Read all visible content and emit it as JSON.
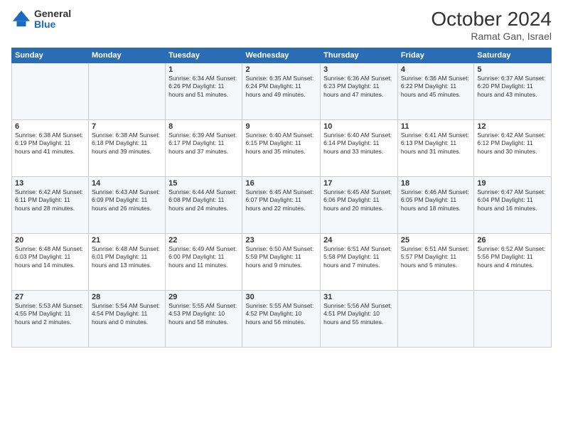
{
  "header": {
    "logo_general": "General",
    "logo_blue": "Blue",
    "month_title": "October 2024",
    "subtitle": "Ramat Gan, Israel"
  },
  "days_of_week": [
    "Sunday",
    "Monday",
    "Tuesday",
    "Wednesday",
    "Thursday",
    "Friday",
    "Saturday"
  ],
  "weeks": [
    [
      {
        "day": "",
        "info": ""
      },
      {
        "day": "",
        "info": ""
      },
      {
        "day": "1",
        "info": "Sunrise: 6:34 AM\nSunset: 6:26 PM\nDaylight: 11 hours and 51 minutes."
      },
      {
        "day": "2",
        "info": "Sunrise: 6:35 AM\nSunset: 6:24 PM\nDaylight: 11 hours and 49 minutes."
      },
      {
        "day": "3",
        "info": "Sunrise: 6:36 AM\nSunset: 6:23 PM\nDaylight: 11 hours and 47 minutes."
      },
      {
        "day": "4",
        "info": "Sunrise: 6:36 AM\nSunset: 6:22 PM\nDaylight: 11 hours and 45 minutes."
      },
      {
        "day": "5",
        "info": "Sunrise: 6:37 AM\nSunset: 6:20 PM\nDaylight: 11 hours and 43 minutes."
      }
    ],
    [
      {
        "day": "6",
        "info": "Sunrise: 6:38 AM\nSunset: 6:19 PM\nDaylight: 11 hours and 41 minutes."
      },
      {
        "day": "7",
        "info": "Sunrise: 6:38 AM\nSunset: 6:18 PM\nDaylight: 11 hours and 39 minutes."
      },
      {
        "day": "8",
        "info": "Sunrise: 6:39 AM\nSunset: 6:17 PM\nDaylight: 11 hours and 37 minutes."
      },
      {
        "day": "9",
        "info": "Sunrise: 6:40 AM\nSunset: 6:15 PM\nDaylight: 11 hours and 35 minutes."
      },
      {
        "day": "10",
        "info": "Sunrise: 6:40 AM\nSunset: 6:14 PM\nDaylight: 11 hours and 33 minutes."
      },
      {
        "day": "11",
        "info": "Sunrise: 6:41 AM\nSunset: 6:13 PM\nDaylight: 11 hours and 31 minutes."
      },
      {
        "day": "12",
        "info": "Sunrise: 6:42 AM\nSunset: 6:12 PM\nDaylight: 11 hours and 30 minutes."
      }
    ],
    [
      {
        "day": "13",
        "info": "Sunrise: 6:42 AM\nSunset: 6:11 PM\nDaylight: 11 hours and 28 minutes."
      },
      {
        "day": "14",
        "info": "Sunrise: 6:43 AM\nSunset: 6:09 PM\nDaylight: 11 hours and 26 minutes."
      },
      {
        "day": "15",
        "info": "Sunrise: 6:44 AM\nSunset: 6:08 PM\nDaylight: 11 hours and 24 minutes."
      },
      {
        "day": "16",
        "info": "Sunrise: 6:45 AM\nSunset: 6:07 PM\nDaylight: 11 hours and 22 minutes."
      },
      {
        "day": "17",
        "info": "Sunrise: 6:45 AM\nSunset: 6:06 PM\nDaylight: 11 hours and 20 minutes."
      },
      {
        "day": "18",
        "info": "Sunrise: 6:46 AM\nSunset: 6:05 PM\nDaylight: 11 hours and 18 minutes."
      },
      {
        "day": "19",
        "info": "Sunrise: 6:47 AM\nSunset: 6:04 PM\nDaylight: 11 hours and 16 minutes."
      }
    ],
    [
      {
        "day": "20",
        "info": "Sunrise: 6:48 AM\nSunset: 6:03 PM\nDaylight: 11 hours and 14 minutes."
      },
      {
        "day": "21",
        "info": "Sunrise: 6:48 AM\nSunset: 6:01 PM\nDaylight: 11 hours and 13 minutes."
      },
      {
        "day": "22",
        "info": "Sunrise: 6:49 AM\nSunset: 6:00 PM\nDaylight: 11 hours and 11 minutes."
      },
      {
        "day": "23",
        "info": "Sunrise: 6:50 AM\nSunset: 5:59 PM\nDaylight: 11 hours and 9 minutes."
      },
      {
        "day": "24",
        "info": "Sunrise: 6:51 AM\nSunset: 5:58 PM\nDaylight: 11 hours and 7 minutes."
      },
      {
        "day": "25",
        "info": "Sunrise: 6:51 AM\nSunset: 5:57 PM\nDaylight: 11 hours and 5 minutes."
      },
      {
        "day": "26",
        "info": "Sunrise: 6:52 AM\nSunset: 5:56 PM\nDaylight: 11 hours and 4 minutes."
      }
    ],
    [
      {
        "day": "27",
        "info": "Sunrise: 5:53 AM\nSunset: 4:55 PM\nDaylight: 11 hours and 2 minutes."
      },
      {
        "day": "28",
        "info": "Sunrise: 5:54 AM\nSunset: 4:54 PM\nDaylight: 11 hours and 0 minutes."
      },
      {
        "day": "29",
        "info": "Sunrise: 5:55 AM\nSunset: 4:53 PM\nDaylight: 10 hours and 58 minutes."
      },
      {
        "day": "30",
        "info": "Sunrise: 5:55 AM\nSunset: 4:52 PM\nDaylight: 10 hours and 56 minutes."
      },
      {
        "day": "31",
        "info": "Sunrise: 5:56 AM\nSunset: 4:51 PM\nDaylight: 10 hours and 55 minutes."
      },
      {
        "day": "",
        "info": ""
      },
      {
        "day": "",
        "info": ""
      }
    ]
  ]
}
